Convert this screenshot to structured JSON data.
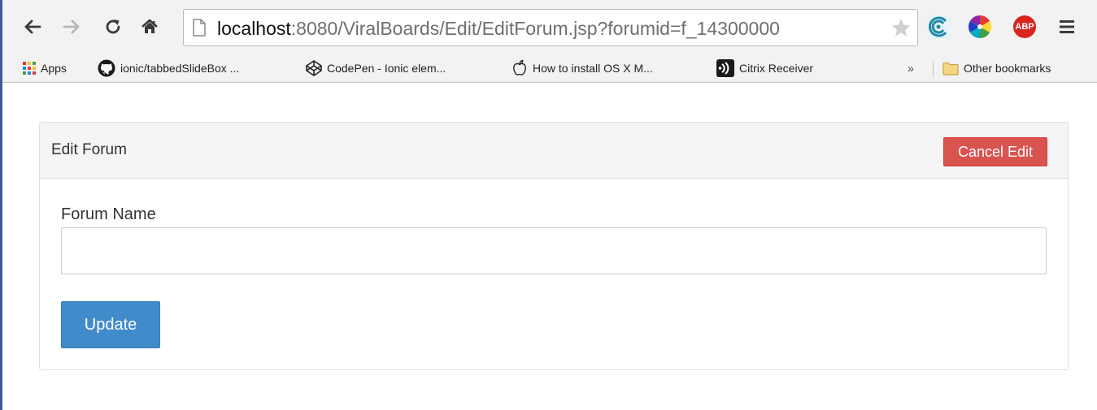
{
  "browser": {
    "url_host": "localhost",
    "url_rest": ":8080/ViralBoards/Edit/EditForum.jsp?forumid=f_14300000",
    "icons": {
      "back": "back-arrow-icon",
      "forward": "forward-arrow-icon",
      "reload": "reload-icon",
      "home": "home-icon",
      "star": "star-icon",
      "menu": "hamburger-menu-icon"
    },
    "extensions": {
      "first": "feed-extension-icon",
      "second": "color-wheel-icon",
      "abp_label": "ABP"
    }
  },
  "bookmarks": {
    "apps_label": "Apps",
    "items": [
      {
        "label": "ionic/tabbedSlideBox ...",
        "icon": "github-icon"
      },
      {
        "label": "CodePen - Ionic elem...",
        "icon": "codepen-icon"
      },
      {
        "label": "How to install OS X M...",
        "icon": "apple-icon"
      },
      {
        "label": "Citrix Receiver",
        "icon": "citrix-icon"
      }
    ],
    "overflow_label": "»",
    "other_label": "Other bookmarks"
  },
  "panel": {
    "title": "Edit Forum",
    "cancel_label": "Cancel Edit",
    "field_label": "Forum Name",
    "field_value": "",
    "update_label": "Update"
  },
  "colors": {
    "cancel": "#d9534f",
    "update": "#428bca",
    "abp": "#d9251d"
  }
}
